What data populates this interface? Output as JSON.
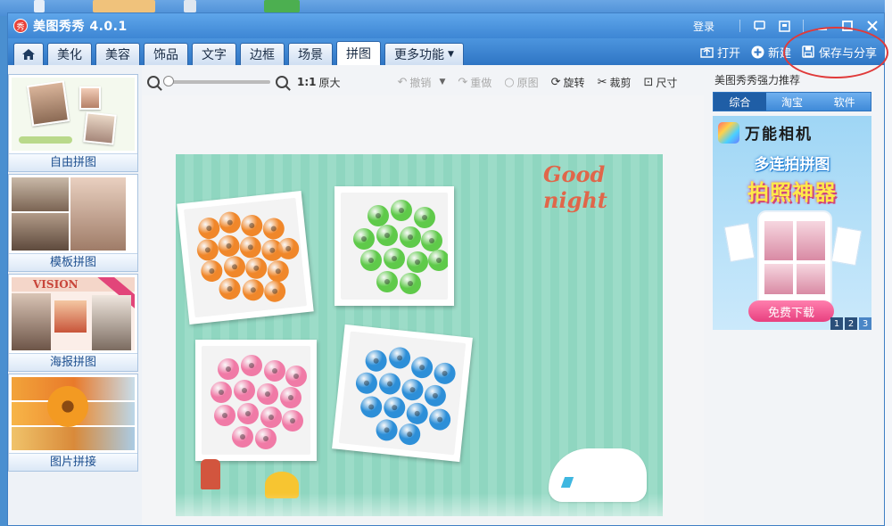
{
  "window": {
    "title": "美图秀秀 4.0.1",
    "logo_char": "秀",
    "login": "登录"
  },
  "menu": {
    "home_icon": "home-icon",
    "tabs": [
      {
        "label": "美化"
      },
      {
        "label": "美容"
      },
      {
        "label": "饰品"
      },
      {
        "label": "文字"
      },
      {
        "label": "边框"
      },
      {
        "label": "场景"
      },
      {
        "label": "拼图",
        "active": true
      },
      {
        "label": "更多功能",
        "dropdown": true
      }
    ],
    "right": {
      "open": "打开",
      "new": "新建",
      "save": "保存与分享"
    }
  },
  "left_panel": {
    "items": [
      {
        "label": "自由拼图"
      },
      {
        "label": "模板拼图"
      },
      {
        "label": "海报拼图"
      },
      {
        "label": "图片拼接"
      }
    ]
  },
  "toolbar": {
    "zoom_ratio": "1:1",
    "original_size": "原大",
    "undo": "撤销",
    "redo": "重做",
    "original": "原图",
    "rotate": "旋转",
    "crop": "裁剪",
    "size": "尺寸",
    "zoom_level": 0
  },
  "canvas": {
    "poster_text": "Good night"
  },
  "right_panel": {
    "title": "美图秀秀强力推荐",
    "tabs": [
      {
        "label": "综合",
        "active": true
      },
      {
        "label": "淘宝"
      },
      {
        "label": "软件"
      }
    ],
    "ad": {
      "brand": "万能相机",
      "line1": "多连拍拼图",
      "line2": "拍照神器",
      "button": "免费下载",
      "pages": [
        "1",
        "2",
        "3"
      ]
    }
  },
  "colors": {
    "title_bar": "#3d86d4",
    "poster_bg": "#8fd6c0",
    "orange_bead": "#f0872a",
    "green_bead": "#5fca4a",
    "pink_bead": "#f07aa6",
    "blue_bead": "#2d8fd8",
    "annotation": "#e03a3a"
  }
}
